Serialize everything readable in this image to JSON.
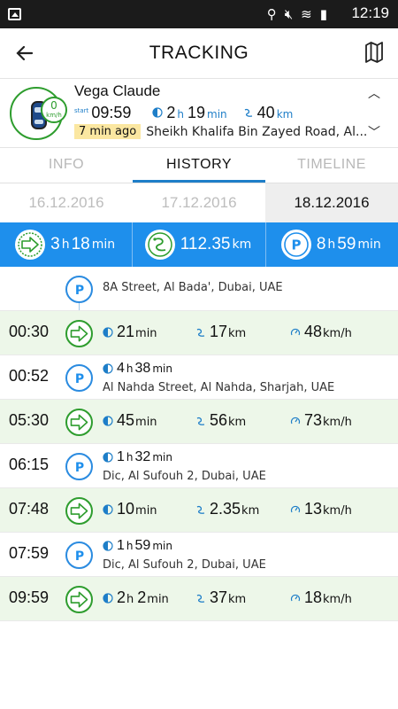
{
  "status_bar": {
    "time": "12:19"
  },
  "header": {
    "title": "TRACKING"
  },
  "vehicle": {
    "name": "Vega Claude",
    "speed": "0",
    "speed_unit": "km/h",
    "start_label": "start",
    "start_time": "09:59",
    "duration_h": "2",
    "duration_h_unit": "h",
    "duration_m": "19",
    "duration_m_unit": "min",
    "distance": "40",
    "distance_unit": "km",
    "ago": "7 min ago",
    "address": "Sheikh Khalifa Bin Zayed Road, Al..."
  },
  "tabs": [
    {
      "label": "INFO"
    },
    {
      "label": "HISTORY"
    },
    {
      "label": "TIMELINE"
    }
  ],
  "dates": [
    {
      "label": "16.12.2016"
    },
    {
      "label": "17.12.2016"
    },
    {
      "label": "18.12.2016"
    }
  ],
  "summary": {
    "driving": {
      "h": "3",
      "h_unit": "h",
      "m": "18",
      "m_unit": "min"
    },
    "distance": {
      "value": "112.35",
      "unit": "km"
    },
    "parking": {
      "h": "8",
      "h_unit": "h",
      "m": "59",
      "m_unit": "min"
    }
  },
  "timeline": {
    "first_stop": {
      "address": "8A Street, Al Bada', Dubai, UAE"
    },
    "rows": [
      {
        "type": "move",
        "time": "00:30",
        "dur_h": "",
        "dur_h_unit": "",
        "dur_m": "21",
        "dur_m_unit": "min",
        "dist": "17",
        "dist_unit": "km",
        "speed": "48",
        "speed_unit": "km/h"
      },
      {
        "type": "stop",
        "time": "00:52",
        "dur_h": "4",
        "dur_h_unit": "h",
        "dur_m": "38",
        "dur_m_unit": "min",
        "address": "Al Nahda Street, Al Nahda, Sharjah, UAE"
      },
      {
        "type": "move",
        "time": "05:30",
        "dur_h": "",
        "dur_h_unit": "",
        "dur_m": "45",
        "dur_m_unit": "min",
        "dist": "56",
        "dist_unit": "km",
        "speed": "73",
        "speed_unit": "km/h"
      },
      {
        "type": "stop",
        "time": "06:15",
        "dur_h": "1",
        "dur_h_unit": "h",
        "dur_m": "32",
        "dur_m_unit": "min",
        "address": "Dic, Al Sufouh 2, Dubai, UAE"
      },
      {
        "type": "move",
        "time": "07:48",
        "dur_h": "",
        "dur_h_unit": "",
        "dur_m": "10",
        "dur_m_unit": "min",
        "dist": "2.35",
        "dist_unit": "km",
        "speed": "13",
        "speed_unit": "km/h"
      },
      {
        "type": "stop",
        "time": "07:59",
        "dur_h": "1",
        "dur_h_unit": "h",
        "dur_m": "59",
        "dur_m_unit": "min",
        "address": "Dic, Al Sufouh 2, Dubai, UAE"
      },
      {
        "type": "move",
        "time": "09:59",
        "dur_h": "2",
        "dur_h_unit": "h",
        "dur_m": "2",
        "dur_m_unit": "min",
        "dist": "37",
        "dist_unit": "km",
        "speed": "18",
        "speed_unit": "km/h"
      }
    ]
  },
  "colors": {
    "accent_blue": "#1e8fec",
    "moving_green": "#2e9d2e",
    "moving_row_bg": "#edf7e9",
    "ago_badge": "#fbe7a1"
  }
}
